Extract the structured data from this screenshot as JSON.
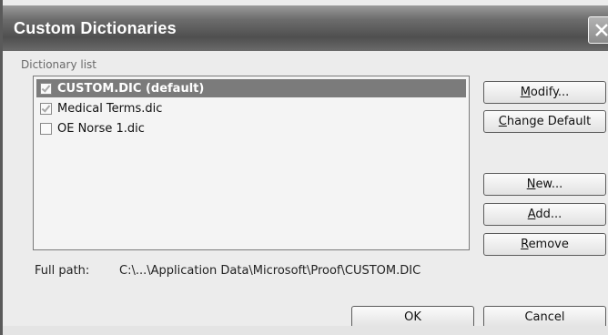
{
  "window": {
    "title": "Custom Dictionaries"
  },
  "dictionary_list": {
    "label": "Dictionary list",
    "items": [
      {
        "label": "CUSTOM.DIC (default)",
        "checked": true,
        "selected": true
      },
      {
        "label": "Medical Terms.dic",
        "checked": true,
        "selected": false
      },
      {
        "label": "OE Norse 1.dic",
        "checked": false,
        "selected": false
      }
    ]
  },
  "buttons": {
    "modify": {
      "underline": "M",
      "rest": "odify..."
    },
    "change_default": {
      "underline": "C",
      "rest": "hange Default"
    },
    "new": {
      "underline": "N",
      "rest": "ew..."
    },
    "add": {
      "underline": "A",
      "rest": "dd..."
    },
    "remove": {
      "underline": "R",
      "rest": "emove"
    },
    "ok": "OK",
    "cancel": "Cancel"
  },
  "full_path": {
    "label": "Full path:",
    "value": "C:\\...\\Application Data\\Microsoft\\Proof\\CUSTOM.DIC"
  },
  "icons": {
    "close": "close-icon",
    "checkbox": "checkmark-icon"
  },
  "colors": {
    "selection": "#7b7b7b",
    "titlebar": "#5a5a5a"
  }
}
